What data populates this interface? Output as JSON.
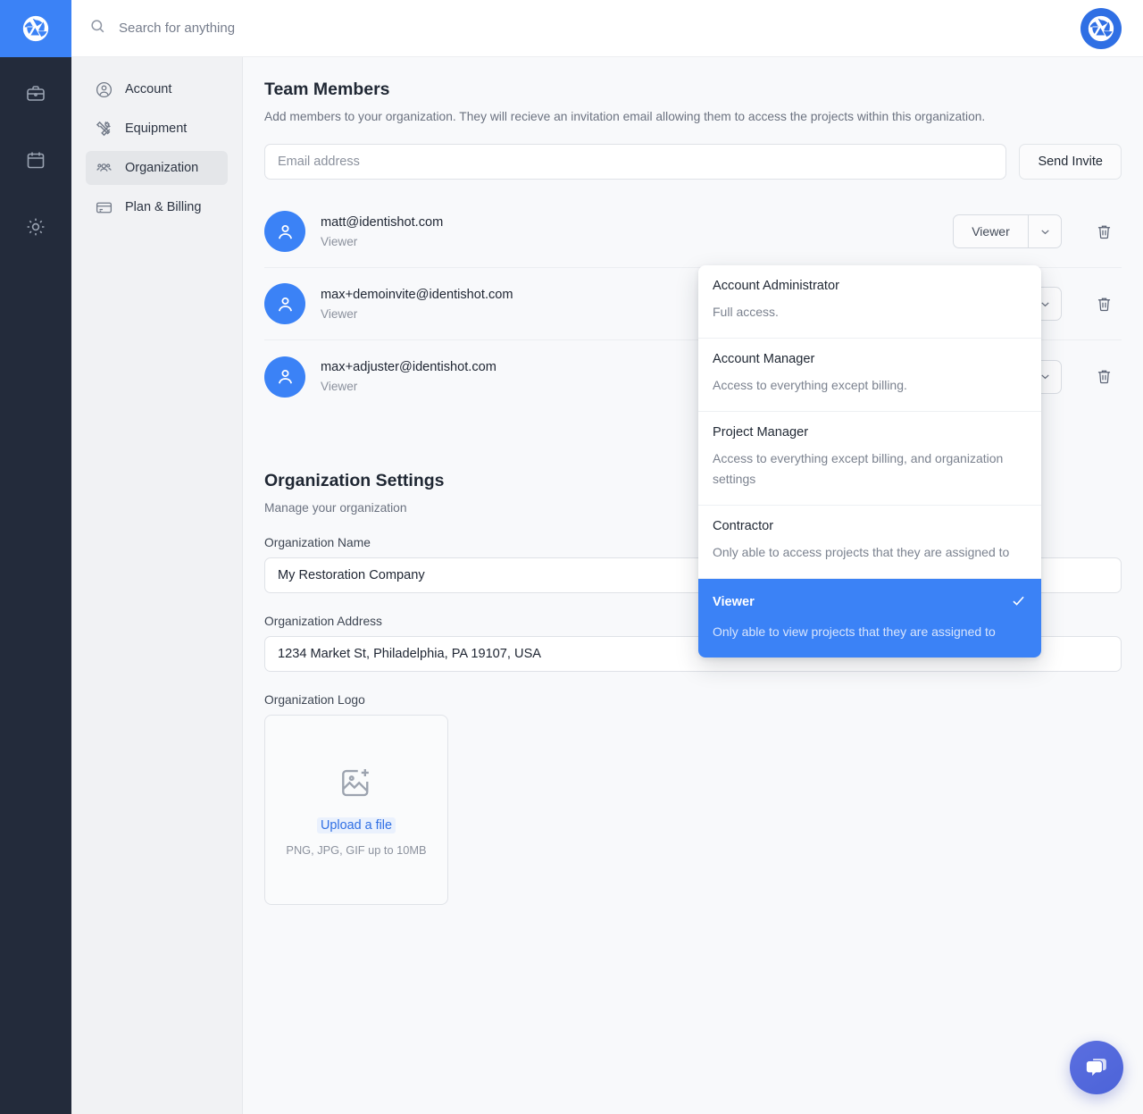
{
  "brand": {
    "logo_icon": "aperture-icon",
    "top_logo_icon": "aperture-icon"
  },
  "rail": {
    "items": [
      {
        "icon": "briefcase-icon",
        "name": "rail-item-projects"
      },
      {
        "icon": "calendar-icon",
        "name": "rail-item-calendar"
      },
      {
        "icon": "gear-icon",
        "name": "rail-item-settings"
      }
    ]
  },
  "search": {
    "placeholder": "Search for anything",
    "value": "",
    "icon": "search-icon"
  },
  "sidebar": {
    "items": [
      {
        "label": "Account",
        "icon": "user-circle-icon",
        "active": false
      },
      {
        "label": "Equipment",
        "icon": "tools-icon",
        "active": false
      },
      {
        "label": "Organization",
        "icon": "users-group-icon",
        "active": true
      },
      {
        "label": "Plan & Billing",
        "icon": "credit-card-icon",
        "active": false
      }
    ]
  },
  "team": {
    "title": "Team Members",
    "description": "Add members to your organization. They will recieve an invitation email allowing them to access the projects within this organization.",
    "email_placeholder": "Email address",
    "email_value": "",
    "send_label": "Send Invite",
    "members": [
      {
        "email": "matt@identishot.com",
        "role": "Viewer",
        "role_button": "Viewer"
      },
      {
        "email": "max+demoinvite@identishot.com",
        "role": "Viewer",
        "role_button": "Viewer"
      },
      {
        "email": "max+adjuster@identishot.com",
        "role": "Viewer",
        "role_button": "Viewer"
      }
    ],
    "delete_icon": "trash-icon",
    "caret_icon": "chevron-down-icon"
  },
  "role_dropdown": {
    "selected": "Viewer",
    "check_icon": "check-icon",
    "options": [
      {
        "label": "Account Administrator",
        "description": "Full access.",
        "selected": false
      },
      {
        "label": "Account Manager",
        "description": "Access to everything except billing.",
        "selected": false
      },
      {
        "label": "Project Manager",
        "description": "Access to everything except billing, and organization settings",
        "selected": false
      },
      {
        "label": "Contractor",
        "description": "Only able to access projects that they are assigned to",
        "selected": false
      },
      {
        "label": "Viewer",
        "description": "Only able to view projects that they are assigned to",
        "selected": true
      }
    ]
  },
  "org": {
    "title": "Organization Settings",
    "subtitle": "Manage your organization",
    "name_label": "Organization Name",
    "name_value": "My Restoration Company",
    "address_label": "Organization Address",
    "address_value": "1234 Market St, Philadelphia, PA 19107, USA",
    "logo_label": "Organization Logo",
    "upload_icon": "image-plus-icon",
    "upload_link": "Upload a file",
    "upload_hint": "PNG, JPG, GIF up to 10MB"
  },
  "chat": {
    "icon": "chat-bubbles-icon"
  },
  "colors": {
    "accent": "#3b82f6",
    "rail": "#232b3b",
    "sidebar": "#f1f2f4",
    "main": "#f8f9fb",
    "chat": "#4c63d8"
  }
}
